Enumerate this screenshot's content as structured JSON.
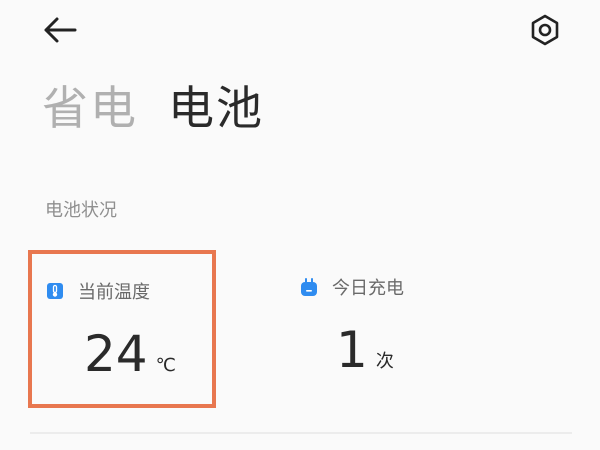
{
  "header": {
    "back_icon": "arrow-left-icon",
    "settings_icon": "gear-icon"
  },
  "tabs": [
    {
      "label": "省电",
      "active": false
    },
    {
      "label": "电池",
      "active": true
    }
  ],
  "section": {
    "title": "电池状况"
  },
  "cards": {
    "temperature": {
      "icon": "thermometer-icon",
      "title": "当前温度",
      "value": "24",
      "unit": "℃",
      "highlighted": true
    },
    "charges_today": {
      "icon": "charger-plug-icon",
      "title": "今日充电",
      "value": "1",
      "unit": "次"
    }
  },
  "colors": {
    "accent_blue": "#2f8cf0",
    "highlight_border": "#e8774f",
    "text_primary": "#2a2a2a",
    "text_muted": "#8f8f8f",
    "tab_inactive": "#b0b0b0",
    "background": "#fafafa"
  }
}
